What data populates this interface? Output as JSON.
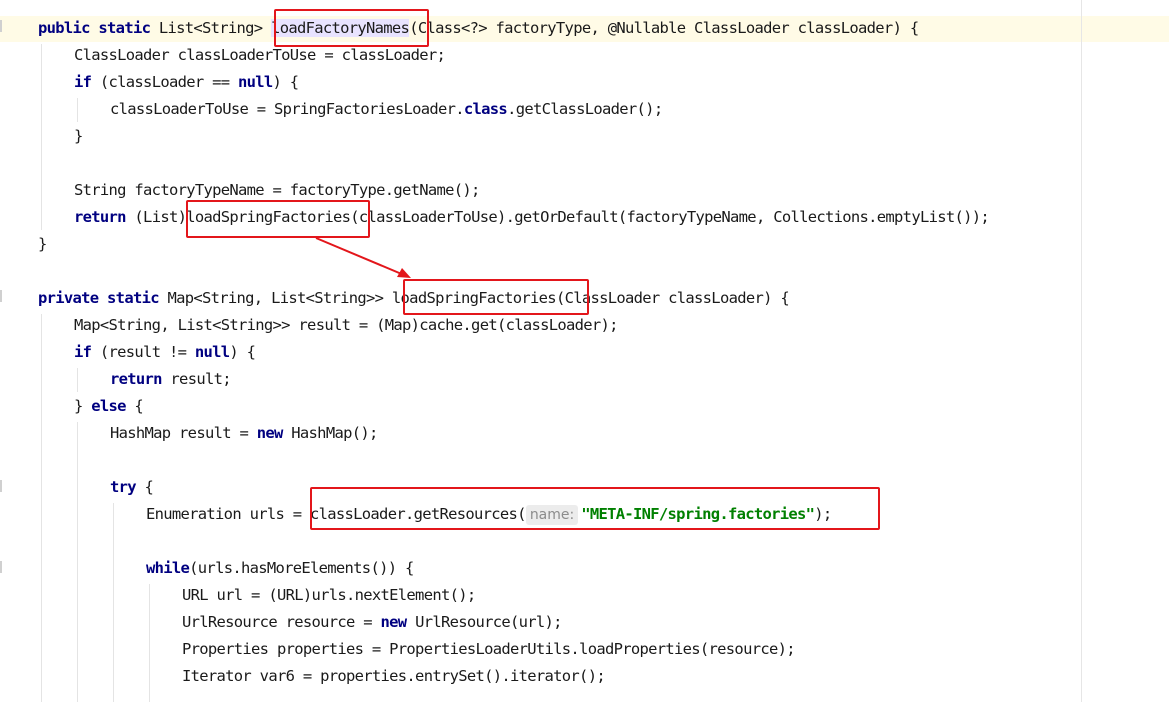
{
  "colors": {
    "keyword": "#000080",
    "string": "#008000",
    "annotation_box": "#e3161b",
    "hint_bg": "#ececec"
  },
  "code": {
    "l1": {
      "kw": "public static ",
      "a": "List<String> ",
      "name": "loadFactoryNames",
      "b": "(Class<?> factoryType, @Nullable ClassLoader classLoader) {"
    },
    "l2": "ClassLoader classLoaderToUse = classLoader;",
    "l3": {
      "kw": "if",
      "a": " (classLoader == ",
      "kw2": "null",
      "b": ") {"
    },
    "l4": {
      "a": "classLoaderToUse = SpringFactoriesLoader.",
      "kw": "class",
      "b": ".getClassLoader();"
    },
    "l5": "}",
    "l6": "String factoryTypeName = factoryType.getName();",
    "l7": {
      "kw": "return",
      "a": " (List)",
      "name": "loadSpringFactories",
      "b": "(classLoaderToUse).getOrDefault(factoryTypeName, Collections.emptyList());"
    },
    "l8": "}",
    "l9": {
      "kw": "private static ",
      "a": "Map<String, List<String>> ",
      "name": "loadSpringFactories",
      "b": "(ClassLoader classLoader) {"
    },
    "l10": "Map<String, List<String>> result = (Map)cache.get(classLoader);",
    "l11": {
      "kw": "if",
      "a": " (result != ",
      "kw2": "null",
      "b": ") {"
    },
    "l12": {
      "kw": "return",
      "a": " result;"
    },
    "l13": {
      "a": "} ",
      "kw": "else",
      "b": " {"
    },
    "l14": {
      "a": "HashMap result = ",
      "kw": "new",
      "b": " HashMap();"
    },
    "l15": {
      "kw": "try",
      "a": " {"
    },
    "l16": {
      "a": "Enumeration urls = classLoader.getResources(",
      "hint": "name:",
      "str": "\"META-INF/spring.factories\"",
      "b": ");"
    },
    "l17": {
      "kw": "while",
      "a": "(urls.hasMoreElements()) {"
    },
    "l18": "URL url = (URL)urls.nextElement();",
    "l19": {
      "a": "UrlResource resource = ",
      "kw": "new",
      "b": " UrlResource(url);"
    },
    "l20": "Properties properties = PropertiesLoaderUtils.loadProperties(resource);",
    "l21": "Iterator var6 = properties.entrySet().iterator();"
  }
}
